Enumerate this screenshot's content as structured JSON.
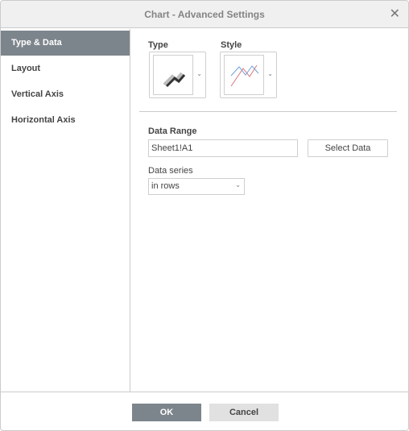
{
  "window": {
    "title": "Chart - Advanced Settings"
  },
  "sidebar": {
    "items": [
      {
        "label": "Type & Data",
        "selected": true
      },
      {
        "label": "Layout"
      },
      {
        "label": "Vertical Axis"
      },
      {
        "label": "Horizontal Axis"
      }
    ]
  },
  "main": {
    "type_label": "Type",
    "type_icon": "line-chart-3d-icon",
    "style_label": "Style",
    "style_icon": "line-chart-style-icon",
    "data_range_label": "Data Range",
    "data_range_value": "Sheet1!A1",
    "select_data_label": "Select Data",
    "data_series_label": "Data series",
    "data_series_value": "in rows"
  },
  "footer": {
    "ok_label": "OK",
    "cancel_label": "Cancel"
  },
  "colors": {
    "accent": "#7d858c",
    "series1": "#6f9fd8",
    "series2": "#d9777a"
  }
}
